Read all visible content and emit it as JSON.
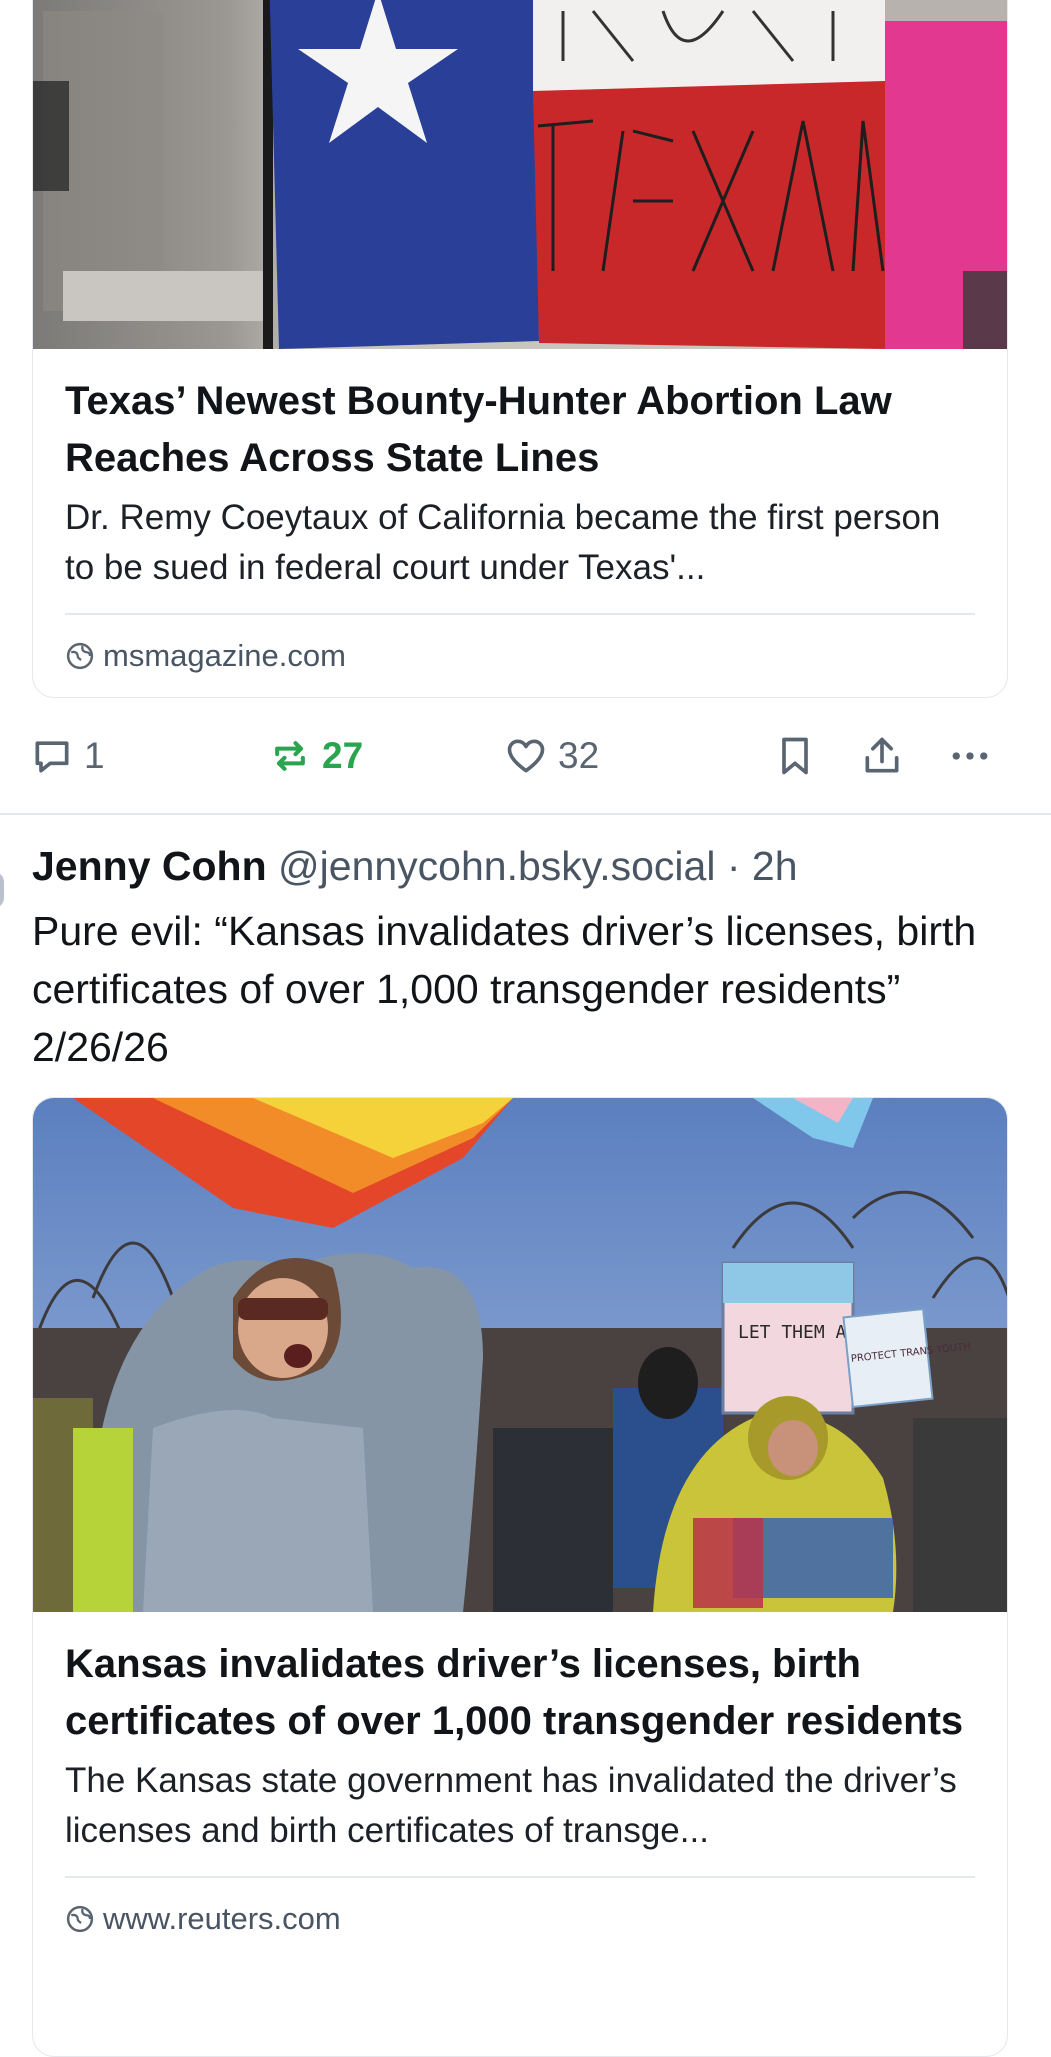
{
  "post1": {
    "card": {
      "image_alt": "Texas flag at protest",
      "title": "Texas’ Newest Bounty-Hunter Abortion Law Reaches Across State Lines",
      "description": "Dr. Remy Coeytaux of California became the first person to be sued in federal court under Texas'...",
      "source": "msmagazine.com"
    },
    "actions": {
      "replies": "1",
      "reposts": "27",
      "likes": "32"
    },
    "colors": {
      "repost_active": "#2aa44f",
      "muted": "#5a6572"
    }
  },
  "post2": {
    "author": "Jenny Cohn",
    "handle": "@jennycohn.bsky.social",
    "time": "· 2h",
    "text": "Pure evil: “Kansas invalidates driver’s licenses, birth certificates of over 1,000 transgender residents” 2/26/26",
    "card": {
      "image_alt": "Transgender rights rally photo",
      "sign_text_1": "LET THEM ALL",
      "sign_text_2": "PROTECT TRANS YOUTH",
      "title": "Kansas invalidates driver’s licenses, birth certificates of over 1,000 transgender residents",
      "description": "The Kansas state government has invalidated the driver’s licenses and birth certificates of transge...",
      "source": "www.reuters.com"
    }
  }
}
